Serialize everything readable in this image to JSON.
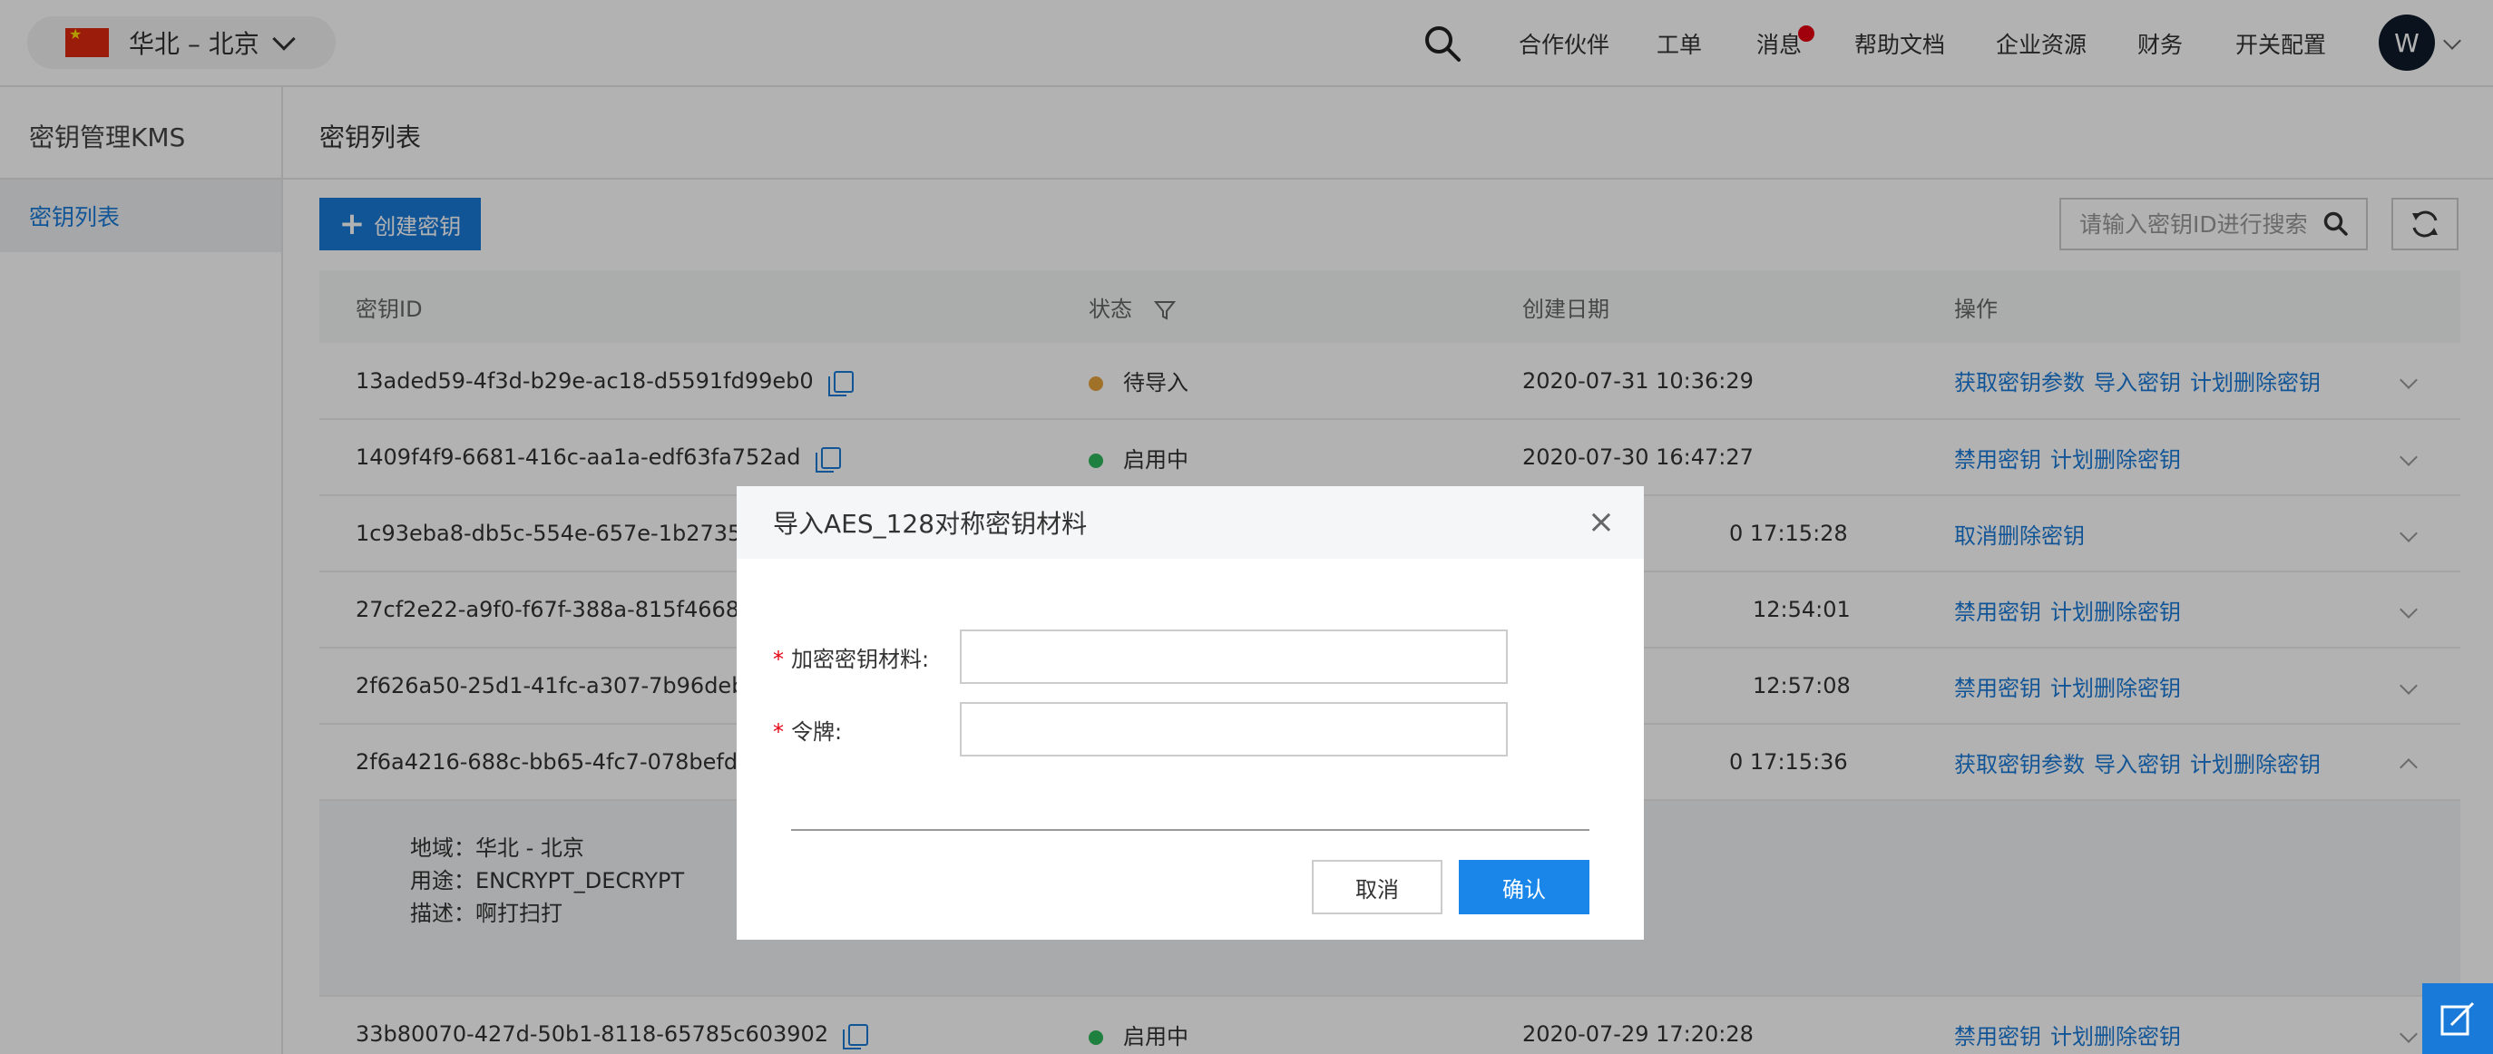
{
  "header": {
    "region": "华北 – 北京",
    "nav": [
      "合作伙伴",
      "工单",
      "消息",
      "帮助文档",
      "企业资源",
      "财务",
      "开关配置"
    ],
    "avatar_initial": "W"
  },
  "sidebar": {
    "title": "密钥管理KMS",
    "items": [
      {
        "label": "密钥列表"
      }
    ]
  },
  "main": {
    "title": "密钥列表",
    "create_label": "创建密钥",
    "search_placeholder": "请输入密钥ID进行搜索"
  },
  "table": {
    "columns": [
      "密钥ID",
      "状态",
      "创建日期",
      "操作"
    ],
    "rows": [
      {
        "id": "13aded59-4f3d-b29e-ac18-d5591fd99eb0",
        "status": "待导入",
        "status_color": "#e6a23c",
        "date": "2020-07-31 10:36:29",
        "actions": [
          "获取密钥参数",
          "导入密钥",
          "计划删除密钥"
        ]
      },
      {
        "id": "1409f4f9-6681-416c-aa1a-edf63fa752ad",
        "status": "启用中",
        "status_color": "#2eb85c",
        "date": "2020-07-30 16:47:27",
        "actions": [
          "禁用密钥",
          "计划删除密钥"
        ]
      },
      {
        "id": "1c93eba8-db5c-554e-657e-1b27358",
        "status": "",
        "status_color": "",
        "date": "0 17:15:28",
        "actions": [
          "取消删除密钥"
        ]
      },
      {
        "id": "27cf2e22-a9f0-f67f-388a-815f4668",
        "status": "",
        "status_color": "",
        "date": "12:54:01",
        "actions": [
          "禁用密钥",
          "计划删除密钥"
        ]
      },
      {
        "id": "2f626a50-25d1-41fc-a307-7b96deb",
        "status": "",
        "status_color": "",
        "date": "12:57:08",
        "actions": [
          "禁用密钥",
          "计划删除密钥"
        ]
      },
      {
        "id": "2f6a4216-688c-bb65-4fc7-078befd",
        "status": "",
        "status_color": "",
        "date": "0 17:15:36",
        "actions": [
          "获取密钥参数",
          "导入密钥",
          "计划删除密钥"
        ]
      },
      {
        "id": "33b80070-427d-50b1-8118-65785c603902",
        "status": "启用中",
        "status_color": "#2eb85c",
        "date": "2020-07-29 17:20:28",
        "actions": [
          "禁用密钥",
          "计划删除密钥"
        ]
      }
    ],
    "detail": {
      "region": "地域：华北 - 北京",
      "usage": "用途：ENCRYPT_DECRYPT",
      "description": "描述：啊打扫打"
    }
  },
  "modal": {
    "title": "导入AES_128对称密钥材料",
    "close": "×",
    "field1_label": "加密密钥材料:",
    "field1_value": "",
    "field2_label": "令牌:",
    "field2_value": "",
    "required_mark": "*",
    "cancel_label": "取消",
    "ok_label": "确认"
  }
}
